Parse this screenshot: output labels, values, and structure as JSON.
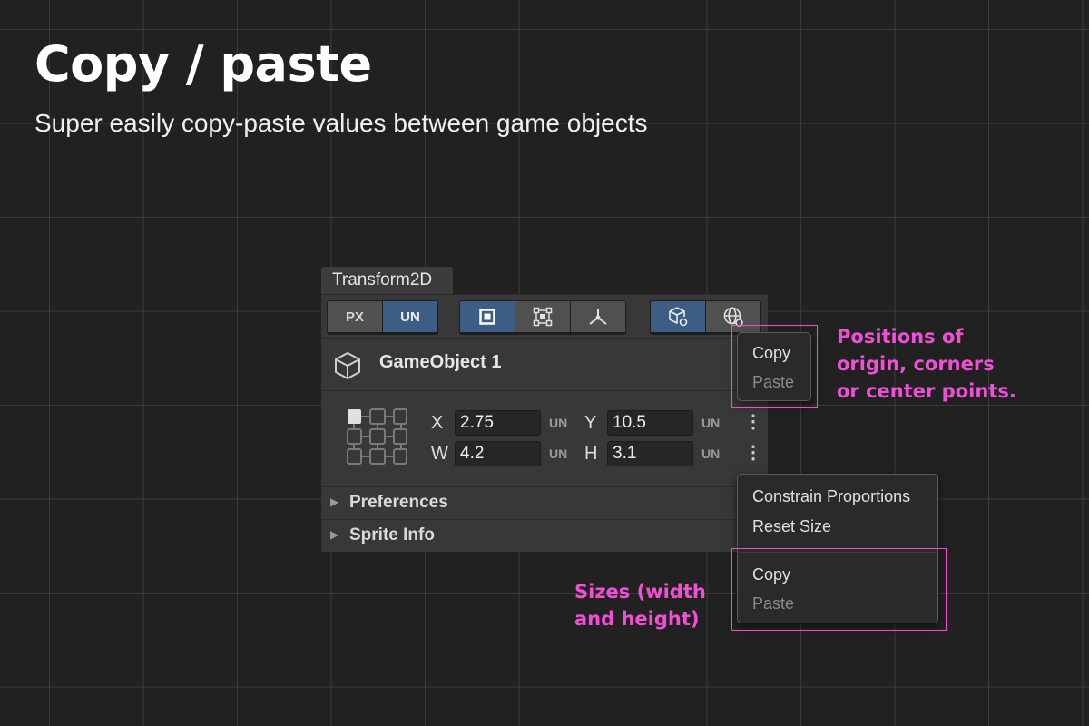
{
  "hero": {
    "title": "Copy / paste",
    "subtitle": "Super easily copy-paste values between game objects"
  },
  "panel": {
    "tab_title": "Transform2D",
    "unit_toggle": {
      "options": [
        "PX",
        "UN"
      ],
      "selected": "UN"
    },
    "mode_buttons": [
      "rect-icon",
      "corners-icon",
      "pivot-icon"
    ],
    "mode_selected": "rect-icon",
    "space_buttons": [
      "local-cube-icon",
      "world-globe-icon"
    ],
    "space_selected": "local-cube-icon",
    "game_object": {
      "name": "GameObject 1",
      "icon": "cube-icon"
    },
    "fields": {
      "x": {
        "label": "X",
        "value": "2.75",
        "unit": "UN"
      },
      "y": {
        "label": "Y",
        "value": "10.5",
        "unit": "UN"
      },
      "w": {
        "label": "W",
        "value": "4.2",
        "unit": "UN"
      },
      "h": {
        "label": "H",
        "value": "3.1",
        "unit": "UN"
      }
    },
    "sections": [
      {
        "label": "Preferences"
      },
      {
        "label": "Sprite Info"
      }
    ]
  },
  "menu_position": {
    "items": [
      {
        "label": "Copy",
        "enabled": true
      },
      {
        "label": "Paste",
        "enabled": false
      }
    ]
  },
  "menu_size": {
    "items": [
      {
        "label": "Constrain Proportions",
        "enabled": true
      },
      {
        "label": "Reset Size",
        "enabled": true
      },
      {
        "label": "Copy",
        "enabled": true
      },
      {
        "label": "Paste",
        "enabled": false
      }
    ]
  },
  "annotations": {
    "positions": [
      "Positions of",
      "origin, corners",
      "or center points."
    ],
    "sizes": [
      "Sizes (width",
      "and height)"
    ]
  },
  "colors": {
    "background": "#212121",
    "grid": "#3a3a3a",
    "accent_selected": "#3e5d85",
    "annotation": "#f04fd6"
  }
}
